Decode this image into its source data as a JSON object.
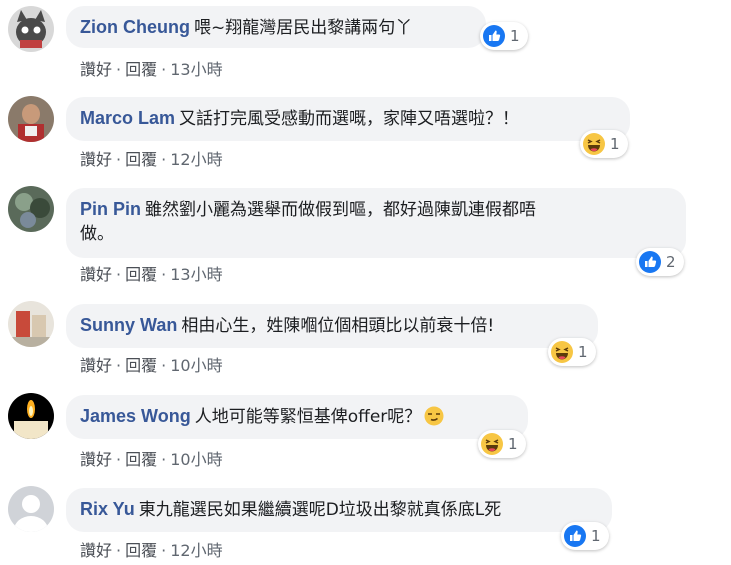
{
  "comments": [
    {
      "author": "Zion Cheung",
      "text": "喂~翔龍灣居民出黎講兩句丫",
      "like_label": "讚好",
      "reply_label": "回覆",
      "time": "13小時",
      "reaction_icon": "like-icon",
      "reaction_count": "1"
    },
    {
      "author": "Marco Lam",
      "text": "又話打完風受感動而選嘅，家陣又唔選啦？！",
      "like_label": "讚好",
      "reply_label": "回覆",
      "time": "12小時",
      "reaction_icon": "haha-icon",
      "reaction_count": "1"
    },
    {
      "author": "Pin Pin",
      "text_line1": "雖然劉小麗為選舉而做假到嘔，都好過陳凱連假都唔",
      "text_line2": "做。",
      "like_label": "讚好",
      "reply_label": "回覆",
      "time": "13小時",
      "reaction_icon": "like-icon",
      "reaction_count": "2"
    },
    {
      "author": "Sunny Wan",
      "text": "相由心生，姓陳嗰位個相頭比以前衰十倍!",
      "like_label": "讚好",
      "reply_label": "回覆",
      "time": "10小時",
      "reaction_icon": "haha-icon",
      "reaction_count": "1"
    },
    {
      "author": "James Wong",
      "text": "人地可能等緊恒基俾offer呢？",
      "like_label": "讚好",
      "reply_label": "回覆",
      "time": "10小時",
      "reaction_icon": "haha-icon",
      "reaction_count": "1"
    },
    {
      "author": "Rix Yu",
      "text": "東九龍選民如果繼續選呢D垃圾出黎就真係底L死",
      "like_label": "讚好",
      "reply_label": "回覆",
      "time": "12小時",
      "reaction_icon": "like-icon",
      "reaction_count": "1"
    }
  ],
  "colors": {
    "author": "#385898",
    "bubble": "#f2f3f5",
    "like_blue": "#1877f2",
    "haha_yellow": "#f7c644"
  }
}
